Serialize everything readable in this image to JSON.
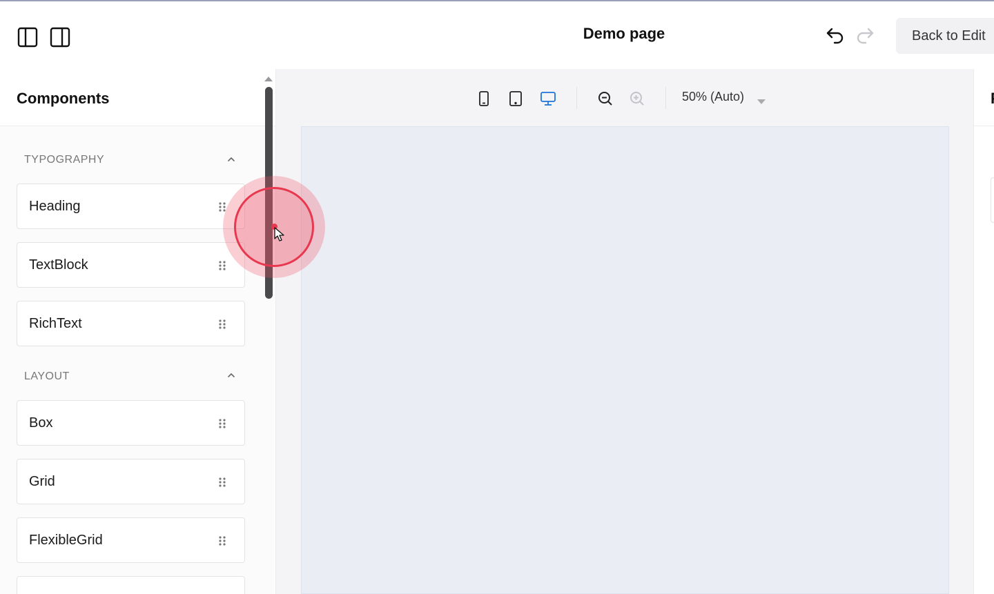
{
  "header": {
    "title": "Demo page",
    "left_sidebar_toggle_icon": "left-sidebar-toggle-icon",
    "right_sidebar_toggle_icon": "right-sidebar-toggle-icon",
    "undo_icon": "undo-icon",
    "redo_icon": "redo-icon",
    "back_label": "Back to Edit"
  },
  "sidebar": {
    "title": "Components",
    "sections": [
      {
        "label": "TYPOGRAPHY",
        "items": [
          {
            "label": "Heading"
          },
          {
            "label": "TextBlock"
          },
          {
            "label": "RichText"
          }
        ]
      },
      {
        "label": "LAYOUT",
        "items": [
          {
            "label": "Box"
          },
          {
            "label": "Grid"
          },
          {
            "label": "FlexibleGrid"
          }
        ]
      }
    ]
  },
  "toolbar": {
    "viewports": [
      "mobile",
      "tablet",
      "desktop"
    ],
    "active_viewport": "desktop",
    "zoom_label": "50% (Auto)"
  },
  "right_panel": {
    "title": "P"
  },
  "colors": {
    "accent": "#1e73d8",
    "click_indicator": "#e8384f",
    "canvas_frame": "#eaeef4"
  }
}
